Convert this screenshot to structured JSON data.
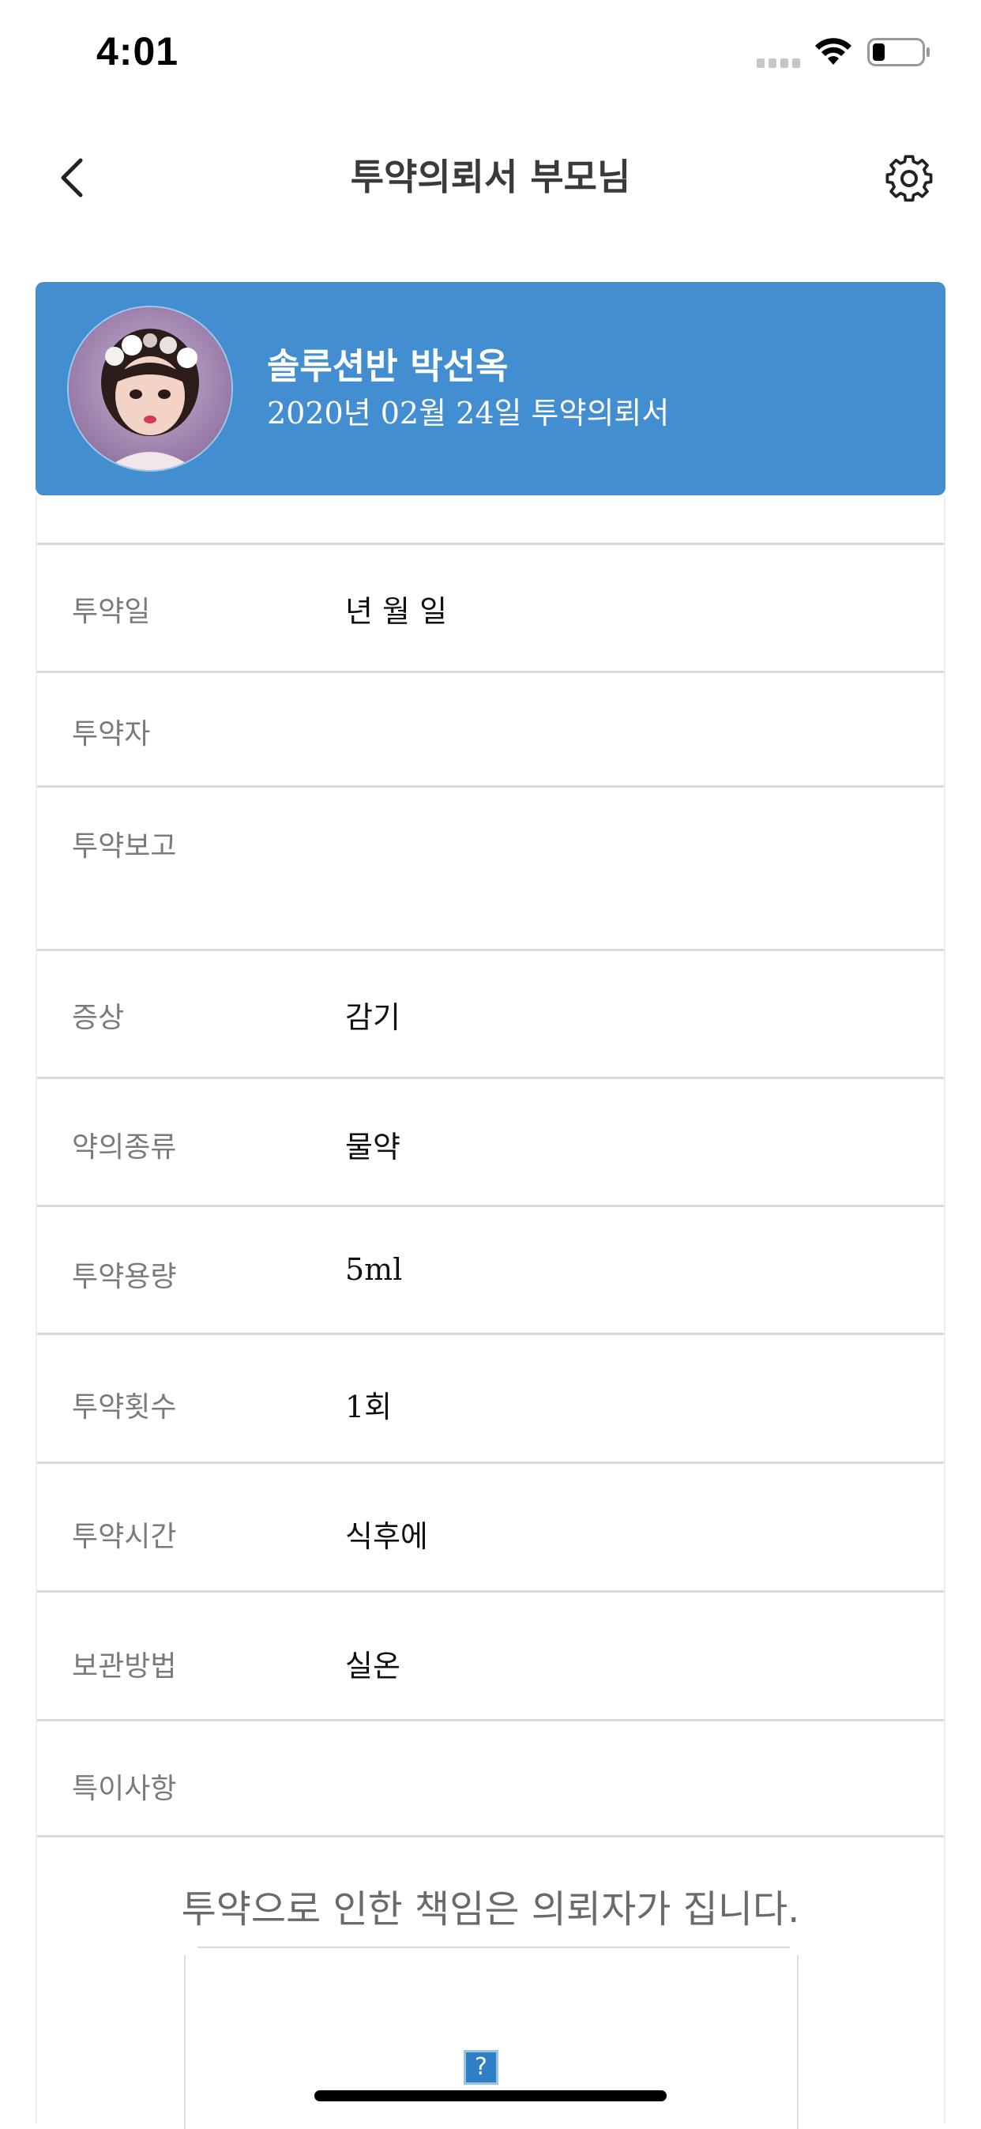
{
  "status_bar": {
    "time": "4:01",
    "icons": [
      "signal-dots-icon",
      "wifi-icon",
      "battery-icon"
    ]
  },
  "nav": {
    "title": "투약의뢰서 부모님",
    "back_icon": "chevron-left-icon",
    "settings_icon": "gear-icon"
  },
  "profile": {
    "name": "솔루션반 박선옥",
    "subtitle": "2020년 02월 24일 투약의뢰서",
    "accent_color": "#438ed0"
  },
  "form": {
    "rows": [
      {
        "label": "투약일",
        "value": "년 월 일"
      },
      {
        "label": "투약자",
        "value": ""
      },
      {
        "label": "투약보고",
        "value": ""
      },
      {
        "label": "증상",
        "value": "감기"
      },
      {
        "label": "약의종류",
        "value": "물약"
      },
      {
        "label": "투약용량",
        "value": "5ml"
      },
      {
        "label": "투약횟수",
        "value": "1회"
      },
      {
        "label": "투약시간",
        "value": "식후에"
      },
      {
        "label": "보관방법",
        "value": "실온"
      },
      {
        "label": "특이사항",
        "value": ""
      }
    ],
    "disclaimer": "투약으로 인한 책임은 의뢰자가 집니다.",
    "signature_placeholder": "?"
  }
}
